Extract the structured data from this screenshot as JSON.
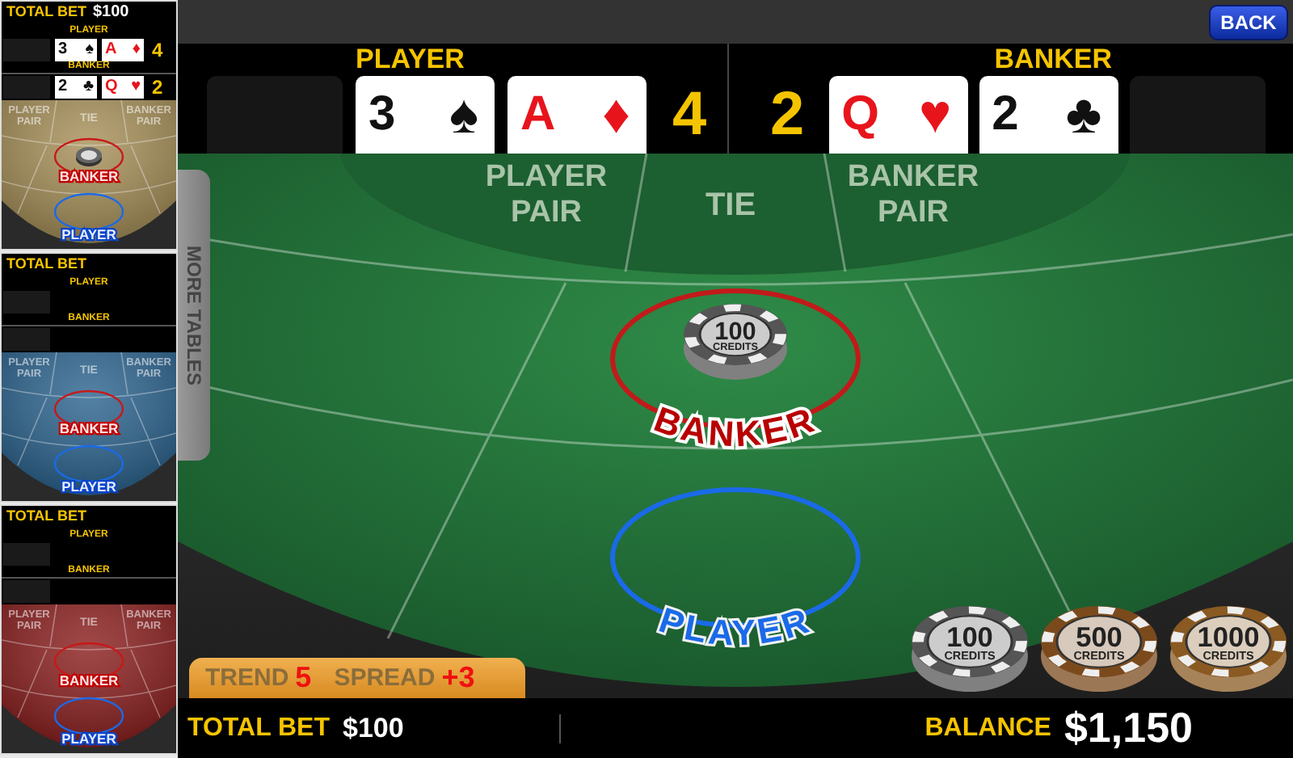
{
  "sidebar": {
    "tables": [
      {
        "color": "#a8915a",
        "total_bet_label": "TOTAL BET",
        "total_bet": "$100",
        "player_label": "PLAYER",
        "player_cards": [
          {
            "rank": "3",
            "suit": "♠",
            "color": "#111111"
          },
          {
            "rank": "A",
            "suit": "♦",
            "color": "#e8141c"
          }
        ],
        "player_score": "4",
        "banker_label": "BANKER",
        "banker_cards": [
          {
            "rank": "2",
            "suit": "♣",
            "color": "#111111"
          },
          {
            "rank": "Q",
            "suit": "♥",
            "color": "#e8141c"
          }
        ],
        "banker_score": "2",
        "player_pair": "PLAYER PAIR",
        "tie": "TIE",
        "banker_pair": "BANKER PAIR",
        "banker_spot": "BANKER",
        "player_spot": "PLAYER",
        "has_bet": true
      },
      {
        "color": "#2d6590",
        "total_bet_label": "TOTAL BET",
        "player_label": "PLAYER",
        "banker_label": "BANKER",
        "player_pair": "PLAYER PAIR",
        "tie": "TIE",
        "banker_pair": "BANKER PAIR",
        "banker_spot": "BANKER",
        "player_spot": "PLAYER",
        "has_bet": false
      },
      {
        "color": "#8c2020",
        "total_bet_label": "TOTAL BET",
        "player_label": "PLAYER",
        "banker_label": "BANKER",
        "player_pair": "PLAYER PAIR",
        "tie": "TIE",
        "banker_pair": "BANKER PAIR",
        "banker_spot": "BANKER",
        "player_spot": "PLAYER",
        "has_bet": false
      }
    ]
  },
  "top_bar": {
    "back_button": "BACK"
  },
  "hand": {
    "player_label": "PLAYER",
    "player_cards": [
      {
        "rank": "3",
        "suit": "♠",
        "color": "#111111"
      },
      {
        "rank": "A",
        "suit": "♦",
        "color": "#e8141c"
      }
    ],
    "player_score": "4",
    "banker_score": "2",
    "banker_cards": [
      {
        "rank": "Q",
        "suit": "♥",
        "color": "#e8141c"
      },
      {
        "rank": "2",
        "suit": "♣",
        "color": "#111111"
      }
    ],
    "banker_label": "BANKER"
  },
  "table": {
    "more_tables": "MORE TABLES",
    "player_pair": "PLAYER PAIR",
    "tie": "TIE",
    "banker_pair": "BANKER PAIR",
    "banker_spot": {
      "label": "BANKER",
      "chip": {
        "value": "100",
        "unit": "CREDITS",
        "color": "#555555"
      }
    },
    "player_spot": {
      "label": "PLAYER"
    },
    "trend": {
      "trend_label": "TREND",
      "trend_value": "5",
      "spread_label": "SPREAD",
      "spread_value": "+3"
    },
    "chips": [
      {
        "value": "100",
        "unit": "CREDITS",
        "color": "#555555"
      },
      {
        "value": "500",
        "unit": "CREDITS",
        "color": "#7b4a1c"
      },
      {
        "value": "1000",
        "unit": "CREDITS",
        "color": "#8a5a22"
      }
    ]
  },
  "bottom_bar": {
    "total_bet_label": "TOTAL BET",
    "total_bet": "$100",
    "balance_label": "BALANCE",
    "balance": "$1,150"
  }
}
